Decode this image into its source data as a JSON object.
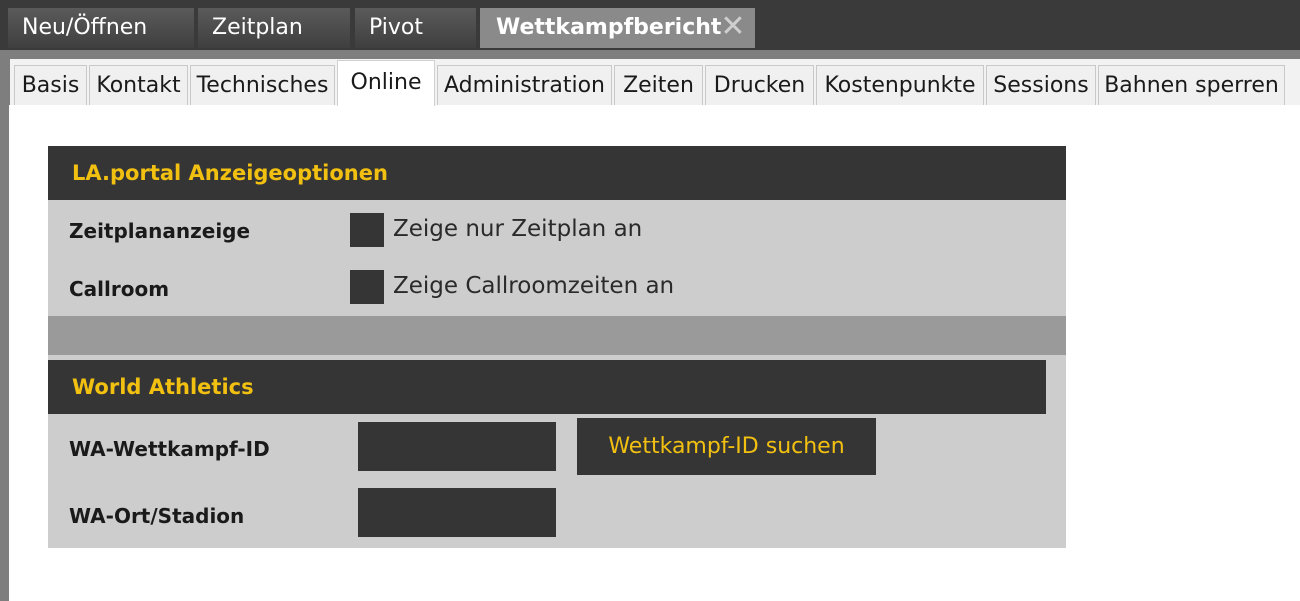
{
  "main_tabs": [
    {
      "label": "Neu/Öffnen"
    },
    {
      "label": "Zeitplan"
    },
    {
      "label": "Pivot"
    },
    {
      "label": "Wettkampfbericht",
      "active": true,
      "closable": true
    }
  ],
  "close_icon": "close-x-icon",
  "sub_tabs": [
    {
      "label": "Basis"
    },
    {
      "label": "Kontakt"
    },
    {
      "label": "Technisches"
    },
    {
      "label": "Online",
      "active": true
    },
    {
      "label": "Administration"
    },
    {
      "label": "Zeiten"
    },
    {
      "label": "Drucken"
    },
    {
      "label": "Kostenpunkte"
    },
    {
      "label": "Sessions"
    },
    {
      "label": "Bahnen sperren"
    }
  ],
  "laportal": {
    "title": "LA.portal Anzeigeoptionen",
    "rows": [
      {
        "label": "Zeitplananzeige",
        "checkbox_label": "Zeige nur Zeitplan an",
        "checked": false
      },
      {
        "label": "Callroom",
        "checkbox_label": "Zeige Callroomzeiten an",
        "checked": false
      }
    ]
  },
  "world_athletics": {
    "title": "World Athletics",
    "competition_id_label": "WA-Wettkampf-ID",
    "competition_id_value": "",
    "search_button_label": "Wettkampf-ID suchen",
    "venue_label": "WA-Ort/Stadion",
    "venue_value": ""
  },
  "colors": {
    "header_bg": "#353535",
    "accent_yellow": "#f2c010",
    "panel_bg": "#cdcdcd",
    "top_bar": "#3a3a3a"
  }
}
